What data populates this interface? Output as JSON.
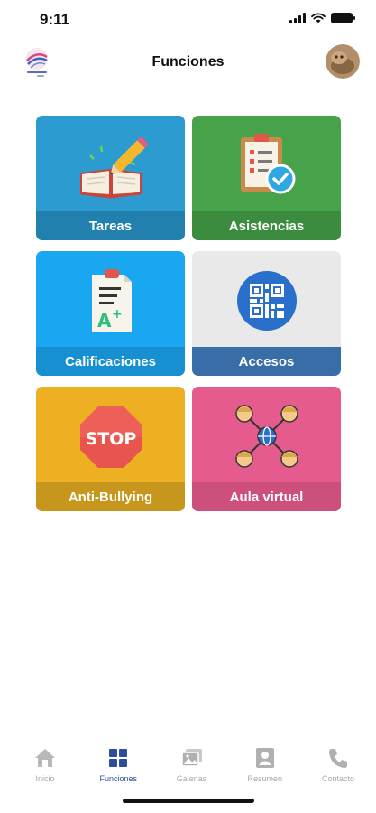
{
  "status_bar": {
    "time": "9:11"
  },
  "header": {
    "title": "Funciones"
  },
  "grid": {
    "items": [
      {
        "label": "Tareas",
        "bg": "#2b9bd0",
        "band": "#2280ae",
        "icon": "book-pencil-icon"
      },
      {
        "label": "Asistencias",
        "bg": "#47a34a",
        "band": "#3b8c3e",
        "icon": "clipboard-check-icon"
      },
      {
        "label": "Calificaciones",
        "bg": "#1aa7f2",
        "band": "#1790d2",
        "icon": "grades-paper-icon"
      },
      {
        "label": "Accesos",
        "bg": "#e9e9e9",
        "band": "#386da8",
        "icon": "qr-code-icon"
      },
      {
        "label": "Anti-Bullying",
        "bg": "#ecb022",
        "band": "#c7961c",
        "icon": "stop-sign-icon"
      },
      {
        "label": "Aula virtual",
        "bg": "#e65b8e",
        "band": "#cc4f7d",
        "icon": "virtual-classroom-icon"
      }
    ]
  },
  "tab_bar": {
    "items": [
      {
        "label": "Inicio",
        "icon": "home-icon",
        "active": false
      },
      {
        "label": "Funciones",
        "icon": "grid-icon",
        "active": true
      },
      {
        "label": "Galerias",
        "icon": "gallery-icon",
        "active": false
      },
      {
        "label": "Resumen",
        "icon": "profile-card-icon",
        "active": false
      },
      {
        "label": "Contacto",
        "icon": "phone-icon",
        "active": false
      }
    ],
    "active_color": "#2c4e9e",
    "inactive_color": "#a9a9a9"
  }
}
